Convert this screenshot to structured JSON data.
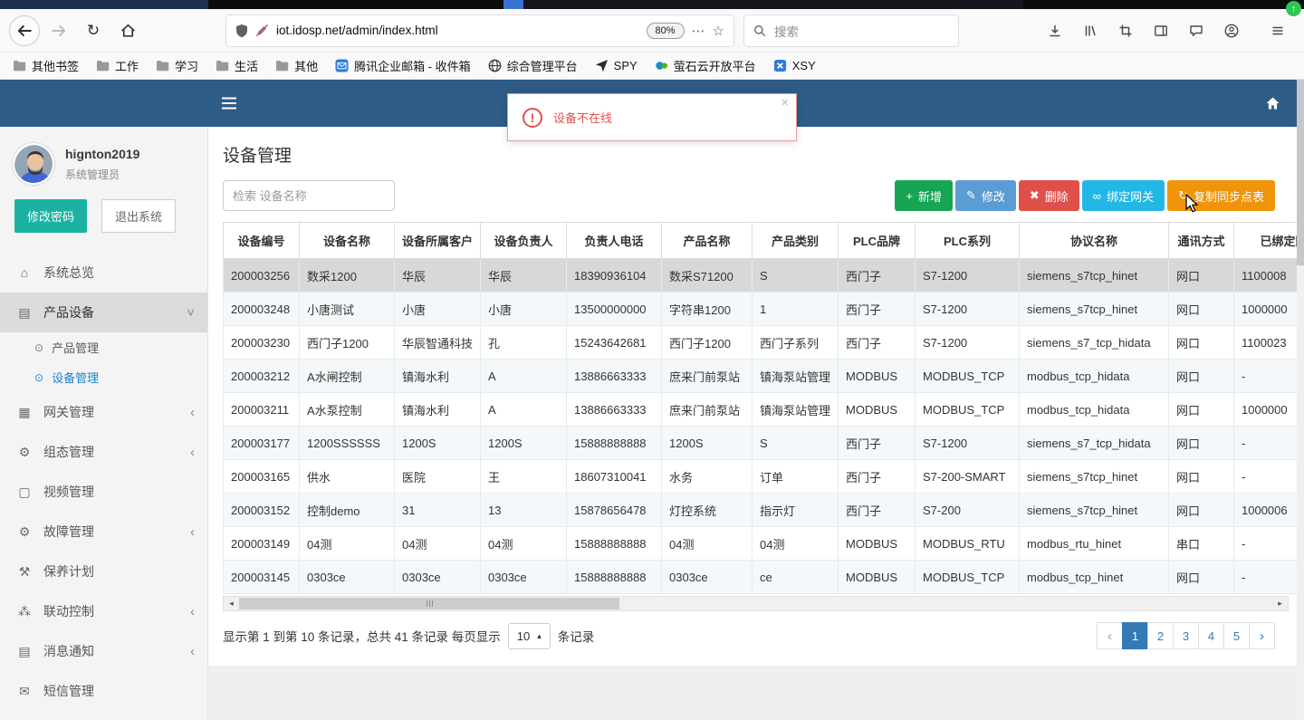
{
  "browser": {
    "url": "iot.idosp.net/admin/index.html",
    "zoom_level": "80%",
    "search_placeholder": "搜索",
    "bookmarks": [
      {
        "label": "其他书签",
        "icon": "folder"
      },
      {
        "label": "工作",
        "icon": "folder"
      },
      {
        "label": "学习",
        "icon": "folder"
      },
      {
        "label": "生活",
        "icon": "folder"
      },
      {
        "label": "其他",
        "icon": "folder"
      },
      {
        "label": "腾讯企业邮箱 - 收件箱",
        "icon": "mail"
      },
      {
        "label": "综合管理平台",
        "icon": "globe"
      },
      {
        "label": "SPY",
        "icon": "plane"
      },
      {
        "label": "萤石云开放平台",
        "icon": "ezviz"
      },
      {
        "label": "XSY",
        "icon": "xsy"
      }
    ]
  },
  "app": {
    "alert": {
      "message": "设备不在线",
      "close": "×"
    },
    "user": {
      "name": "hignton2019",
      "role": "系统管理员"
    },
    "profile_buttons": {
      "change_password": "修改密码",
      "logout": "退出系统"
    },
    "sidebar": [
      {
        "key": "system-overview",
        "label": "系统总览",
        "icon": "home"
      },
      {
        "key": "product-device",
        "label": "产品设备",
        "icon": "device",
        "state": "expanded",
        "active": true,
        "children": [
          {
            "key": "product-mgmt",
            "label": "产品管理",
            "current": false
          },
          {
            "key": "device-mgmt",
            "label": "设备管理",
            "current": true
          }
        ]
      },
      {
        "key": "gateway-mgmt",
        "label": "网关管理",
        "icon": "gateway",
        "state": "collapsed"
      },
      {
        "key": "scada-mgmt",
        "label": "组态管理",
        "icon": "gears",
        "state": "collapsed"
      },
      {
        "key": "video-mgmt",
        "label": "视频管理",
        "icon": "monitor"
      },
      {
        "key": "fault-mgmt",
        "label": "故障管理",
        "icon": "gears",
        "state": "collapsed"
      },
      {
        "key": "maintenance-plan",
        "label": "保养计划",
        "icon": "wrench"
      },
      {
        "key": "linkage-control",
        "label": "联动控制",
        "icon": "sitemap",
        "state": "collapsed"
      },
      {
        "key": "message-notify",
        "label": "消息通知",
        "icon": "book",
        "state": "collapsed"
      },
      {
        "key": "sms-mgmt",
        "label": "短信管理",
        "icon": "envelope"
      }
    ],
    "page_title": "设备管理",
    "toolbar": {
      "search_placeholder": "检索 设备名称",
      "buttons": [
        {
          "key": "add",
          "label": "新增",
          "icon": "plus",
          "color": "#17a554"
        },
        {
          "key": "edit",
          "label": "修改",
          "icon": "pencil",
          "color": "#5a9cd3"
        },
        {
          "key": "delete",
          "label": "删除",
          "icon": "cross",
          "color": "#e0504b"
        },
        {
          "key": "bind-gateway",
          "label": "绑定网关",
          "icon": "link",
          "color": "#23b7e5"
        },
        {
          "key": "copy-sync-table",
          "label": "复制同步点表",
          "icon": "sync",
          "color": "#ef940b"
        }
      ]
    },
    "table": {
      "columns": [
        "设备编号",
        "设备名称",
        "设备所属客户",
        "设备负责人",
        "负责人电话",
        "产品名称",
        "产品类别",
        "PLC品牌",
        "PLC系列",
        "协议名称",
        "通讯方式",
        "已绑定网"
      ],
      "selected_row_index": 0,
      "rows": [
        [
          "200003256",
          "数采1200",
          "华辰",
          "华辰",
          "18390936104",
          "数采S71200",
          "S",
          "西门子",
          "S7-1200",
          "siemens_s7tcp_hinet",
          "网口",
          "1100008"
        ],
        [
          "200003248",
          "小唐测试",
          "小唐",
          "小唐",
          "13500000000",
          "字符串1200",
          "1",
          "西门子",
          "S7-1200",
          "siemens_s7tcp_hinet",
          "网口",
          "1000000"
        ],
        [
          "200003230",
          "西门子1200",
          "华辰智通科技",
          "孔",
          "15243642681",
          "西门子1200",
          "西门子系列",
          "西门子",
          "S7-1200",
          "siemens_s7_tcp_hidata",
          "网口",
          "1100023"
        ],
        [
          "200003212",
          "A水闸控制",
          "镇海水利",
          "A",
          "13886663333",
          "庶来门前泵站",
          "镇海泵站管理",
          "MODBUS",
          "MODBUS_TCP",
          "modbus_tcp_hidata",
          "网口",
          "-"
        ],
        [
          "200003211",
          "A水泵控制",
          "镇海水利",
          "A",
          "13886663333",
          "庶来门前泵站",
          "镇海泵站管理",
          "MODBUS",
          "MODBUS_TCP",
          "modbus_tcp_hidata",
          "网口",
          "1000000"
        ],
        [
          "200003177",
          "1200SSSSSS",
          "1200S",
          "1200S",
          "15888888888",
          "1200S",
          "S",
          "西门子",
          "S7-1200",
          "siemens_s7_tcp_hidata",
          "网口",
          "-"
        ],
        [
          "200003165",
          "供水",
          "医院",
          "王",
          "18607310041",
          "水务",
          "订单",
          "西门子",
          "S7-200-SMART",
          "siemens_s7tcp_hinet",
          "网口",
          "-"
        ],
        [
          "200003152",
          "控制demo",
          "31",
          "13",
          "15878656478",
          "灯控系统",
          "指示灯",
          "西门子",
          "S7-200",
          "siemens_s7tcp_hinet",
          "网口",
          "1000006"
        ],
        [
          "200003149",
          "04测",
          "04测",
          "04测",
          "15888888888",
          "04测",
          "04测",
          "MODBUS",
          "MODBUS_RTU",
          "modbus_rtu_hinet",
          "串口",
          "-"
        ],
        [
          "200003145",
          "0303ce",
          "0303ce",
          "0303ce",
          "15888888888",
          "0303ce",
          "ce",
          "MODBUS",
          "MODBUS_TCP",
          "modbus_tcp_hinet",
          "网口",
          "-"
        ]
      ]
    },
    "pagination": {
      "summary_prefix": "显示第 1 到第 10 条记录，总共 41 条记录 每页显示",
      "page_size": "10",
      "page_size_caret": "▴",
      "summary_suffix": "条记录",
      "prev": "‹",
      "next": "›",
      "pages": [
        "1",
        "2",
        "3",
        "4",
        "5"
      ],
      "active_page": "1"
    }
  }
}
